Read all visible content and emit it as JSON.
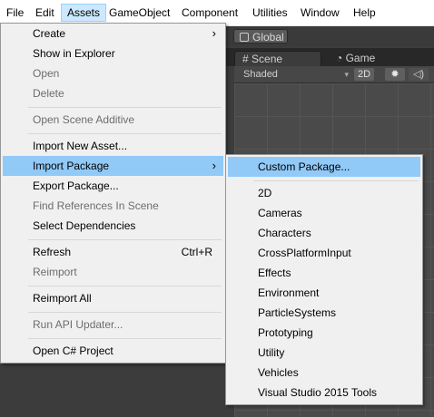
{
  "menubar": [
    "File",
    "Edit",
    "Assets",
    "GameObject",
    "Component",
    "Utilities",
    "Window",
    "Help"
  ],
  "editor": {
    "global_label": "Global",
    "scene_tab": "Scene",
    "game_tab": "Game",
    "shading_mode": "Shaded",
    "mode_2d": "2D"
  },
  "assets_menu": {
    "create": "Create",
    "show_in_explorer": "Show in Explorer",
    "open": "Open",
    "delete": "Delete",
    "open_scene_additive": "Open Scene Additive",
    "import_new_asset": "Import New Asset...",
    "import_package": "Import Package",
    "export_package": "Export Package...",
    "find_references": "Find References In Scene",
    "select_dependencies": "Select Dependencies",
    "refresh": "Refresh",
    "refresh_shortcut": "Ctrl+R",
    "reimport": "Reimport",
    "reimport_all": "Reimport All",
    "run_api_updater": "Run API Updater...",
    "open_csharp_project": "Open C# Project"
  },
  "import_package_menu": {
    "custom_package": "Custom Package...",
    "items": [
      "2D",
      "Cameras",
      "Characters",
      "CrossPlatformInput",
      "Effects",
      "Environment",
      "ParticleSystems",
      "Prototyping",
      "Utility",
      "Vehicles",
      "Visual Studio 2015 Tools"
    ]
  },
  "colors": {
    "highlight": "#91c9f7",
    "menubar_active": "#cce8ff",
    "menu_bg": "#f0f0f0"
  }
}
